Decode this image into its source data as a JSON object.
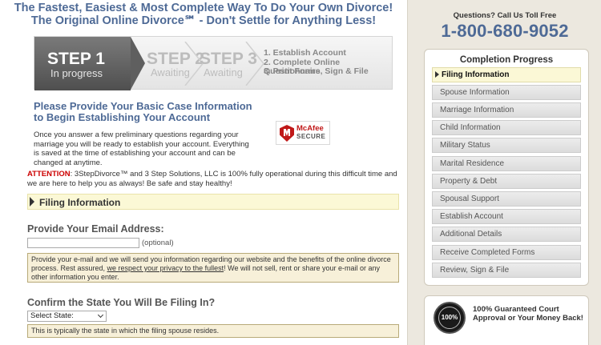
{
  "header": {
    "line1": "The Fastest, Easiest & Most Complete Way To Do Your Own Divorce!",
    "line2": "The Original Online Divorce℠ - Don't Settle for Anything Less!"
  },
  "steps": {
    "step1": {
      "title": "STEP 1",
      "status": "In progress"
    },
    "step2": {
      "title": "STEP 2",
      "status": "Awaiting"
    },
    "step3": {
      "title": "STEP 3",
      "status": "Awaiting"
    },
    "list": [
      "1. Establish Account",
      "2. Complete Online Questionnaire",
      "3. Print Forms, Sign & File"
    ]
  },
  "case": {
    "title": "Please Provide Your Basic Case Information to Begin Establishing Your Account",
    "description": "Once you answer a few preliminary questions regarding your marriage you will be ready to establish your account. Everything is saved at the time of establishing your account and can be changed at anytime."
  },
  "mcafee": {
    "brand": "McAfee",
    "label": "SECURE"
  },
  "attention": {
    "label": "ATTENTION",
    "text": ": 3StepDivorce™ and 3 Step Solutions, LLC is 100% fully operational during this difficult time and we are here to help you as always! Be safe and stay healthy!"
  },
  "section": {
    "label": "Filing Information"
  },
  "email": {
    "question": "Provide Your Email Address:",
    "value": "",
    "optional": "(optional)",
    "note_before": "Provide your e-mail and we will send you information regarding our website and the benefits of the online divorce process. Rest assured, ",
    "note_link": "we respect your privacy to the fullest",
    "note_after": "! We will not sell, rent or share your e-mail or any other information you enter."
  },
  "state": {
    "question": "Confirm the State You Will Be Filing In?",
    "selected": "Select State:",
    "note": "This is typically the state in which the filing spouse resides."
  },
  "sidebar": {
    "call_label": "Questions? Call Us Toll Free",
    "phone": "1-800-680-9052",
    "progress_title": "Completion Progress",
    "items": [
      {
        "label": "Filing Information",
        "active": true
      },
      {
        "label": "Spouse Information",
        "active": false
      },
      {
        "label": "Marriage Information",
        "active": false
      },
      {
        "label": "Child Information",
        "active": false
      },
      {
        "label": "Military Status",
        "active": false
      },
      {
        "label": "Marital Residence",
        "active": false
      },
      {
        "label": "Property & Debt",
        "active": false
      },
      {
        "label": "Spousal Support",
        "active": false
      },
      {
        "label": "Establish Account",
        "active": false
      },
      {
        "label": "Additional Details",
        "active": false
      },
      {
        "label": "Receive Completed Forms",
        "active": false
      },
      {
        "label": "Review, Sign & File",
        "active": false
      }
    ],
    "guarantee_seal": "100%",
    "guarantee_text": "100% Guaranteed Court Approval or Your Money Back!"
  },
  "colors": {
    "heading_blue": "#4e6a96",
    "attention_red": "#cc0000",
    "active_highlight": "#fbf8d6",
    "sidebar_bg": "#ece8df"
  }
}
